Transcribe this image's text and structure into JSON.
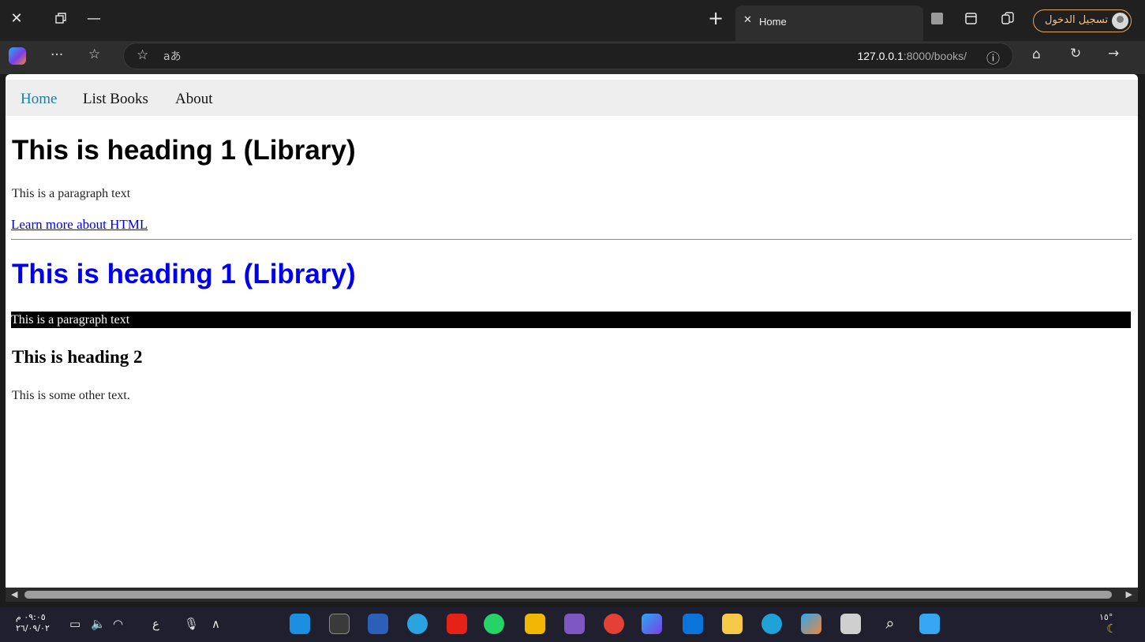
{
  "browser": {
    "tab_title": "Home",
    "url_host": "127.0.0.1",
    "url_path": ":8000/books/",
    "signin_label": "تسجيل الدخول",
    "read_aloud_glyph": "aあ"
  },
  "page": {
    "nav": [
      {
        "label": "Home",
        "active": true
      },
      {
        "label": "List Books"
      },
      {
        "label": "About"
      }
    ],
    "heading1": "This is heading 1 (Library)",
    "paragraph1": "This is a paragraph text",
    "link": "Learn more about HTML",
    "heading1_blue": "This is heading 1 (Library)",
    "paragraph_dark": "This is a paragraph text",
    "heading2": "This is heading 2",
    "paragraph3": "This is some other text."
  },
  "taskbar": {
    "time": "٠٩:٠٥ م",
    "date": "٢٦/٠٩/٠٢",
    "input_lang": "ع",
    "weather": "١٥°"
  },
  "colors": {
    "link": "#0000ee",
    "nav_active": "#1a7fa9",
    "signin_border": "#e8a25a"
  }
}
